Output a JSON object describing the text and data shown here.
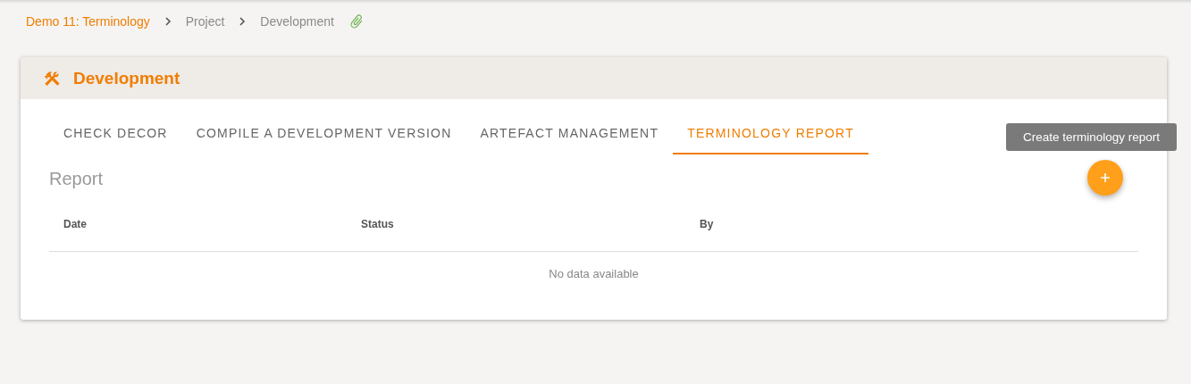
{
  "breadcrumb": [
    {
      "label": "Demo 11: Terminology",
      "kind": "link"
    },
    {
      "label": "Project",
      "kind": "plain"
    },
    {
      "label": "Development",
      "kind": "plain"
    }
  ],
  "panel": {
    "title": "Development"
  },
  "tabs": [
    {
      "label": "CHECK DECOR",
      "selected": false
    },
    {
      "label": "COMPILE A DEVELOPMENT VERSION",
      "selected": false
    },
    {
      "label": "ARTEFACT MANAGEMENT",
      "selected": false
    },
    {
      "label": "TERMINOLOGY REPORT",
      "selected": true
    }
  ],
  "section": {
    "title": "Report"
  },
  "table": {
    "columns": [
      "Date",
      "Status",
      "By"
    ],
    "empty_message": "No data available"
  },
  "tooltip": "Create terminology report"
}
